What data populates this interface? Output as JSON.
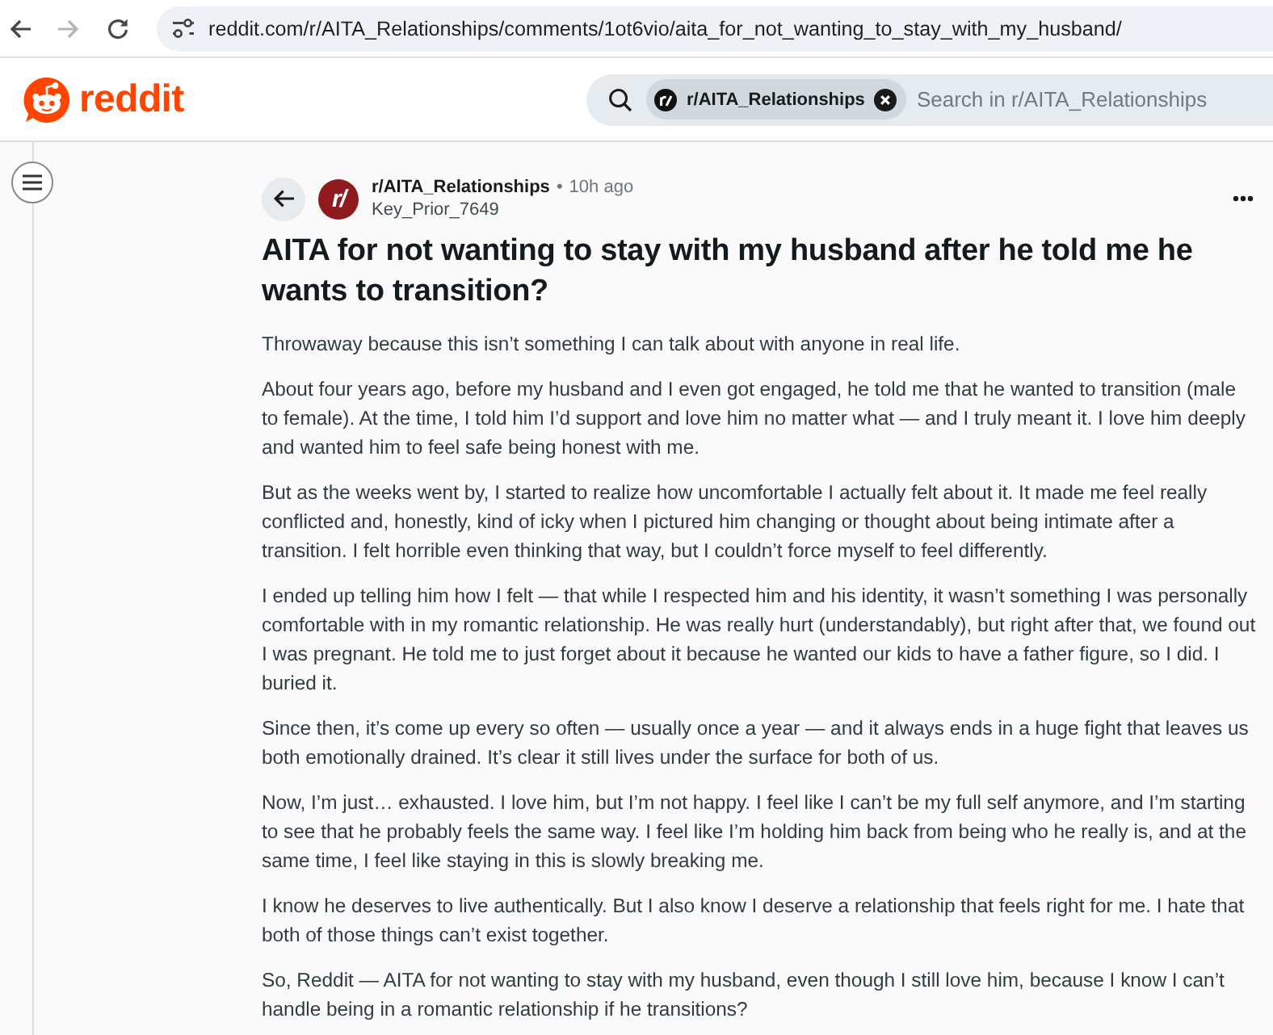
{
  "browser": {
    "nav_buttons": [
      {
        "kind": "back",
        "disabled": false
      },
      {
        "kind": "forward",
        "disabled": true
      },
      {
        "kind": "reload",
        "disabled": false
      }
    ],
    "url": "reddit.com/r/AITA_Relationships/comments/1ot6vio/aita_for_not_wanting_to_stay_with_my_husband/"
  },
  "header": {
    "logo_text": "reddit",
    "search": {
      "scope_chip": "r/AITA_Relationships",
      "placeholder": "Search in r/AITA_Relationships"
    }
  },
  "post": {
    "avatar_label": "r/",
    "community": "r/AITA_Relationships",
    "separator": "•",
    "age": "10h ago",
    "author": "Key_Prior_7649",
    "title": "AITA for not wanting to stay with my husband after he told me he wants to transition?",
    "body": [
      "Throwaway because this isn’t something I can talk about with anyone in real life.",
      "About four years ago, before my husband and I even got engaged, he told me that he wanted to transition (male to female). At the time, I told him I’d support and love him no matter what — and I truly meant it. I love him deeply and wanted him to feel safe being honest with me.",
      "But as the weeks went by, I started to realize how uncomfortable I actually felt about it. It made me feel really conflicted and, honestly, kind of icky when I pictured him changing or thought about being intimate after a transition. I felt horrible even thinking that way, but I couldn’t force myself to feel differently.",
      "I ended up telling him how I felt — that while I respected him and his identity, it wasn’t something I was personally comfortable with in my romantic relationship. He was really hurt (understandably), but right after that, we found out I was pregnant. He told me to just forget about it because he wanted our kids to have a father figure, so I did. I buried it.",
      "Since then, it’s come up every so often — usually once a year — and it always ends in a huge fight that leaves us both emotionally drained. It’s clear it still lives under the surface for both of us.",
      "Now, I’m just… exhausted. I love him, but I’m not happy. I feel like I can’t be my full self anymore, and I’m starting to see that he probably feels the same way. I feel like I’m holding him back from being who he really is, and at the same time, I feel like staying in this is slowly breaking me.",
      "I know he deserves to live authentically. But I also know I deserve a relationship that feels right for me. I hate that both of those things can’t exist together.",
      "So, Reddit — AITA for not wanting to stay with my husband, even though I still love him, because I know I can’t handle being in a romantic relationship if he transitions?"
    ]
  }
}
